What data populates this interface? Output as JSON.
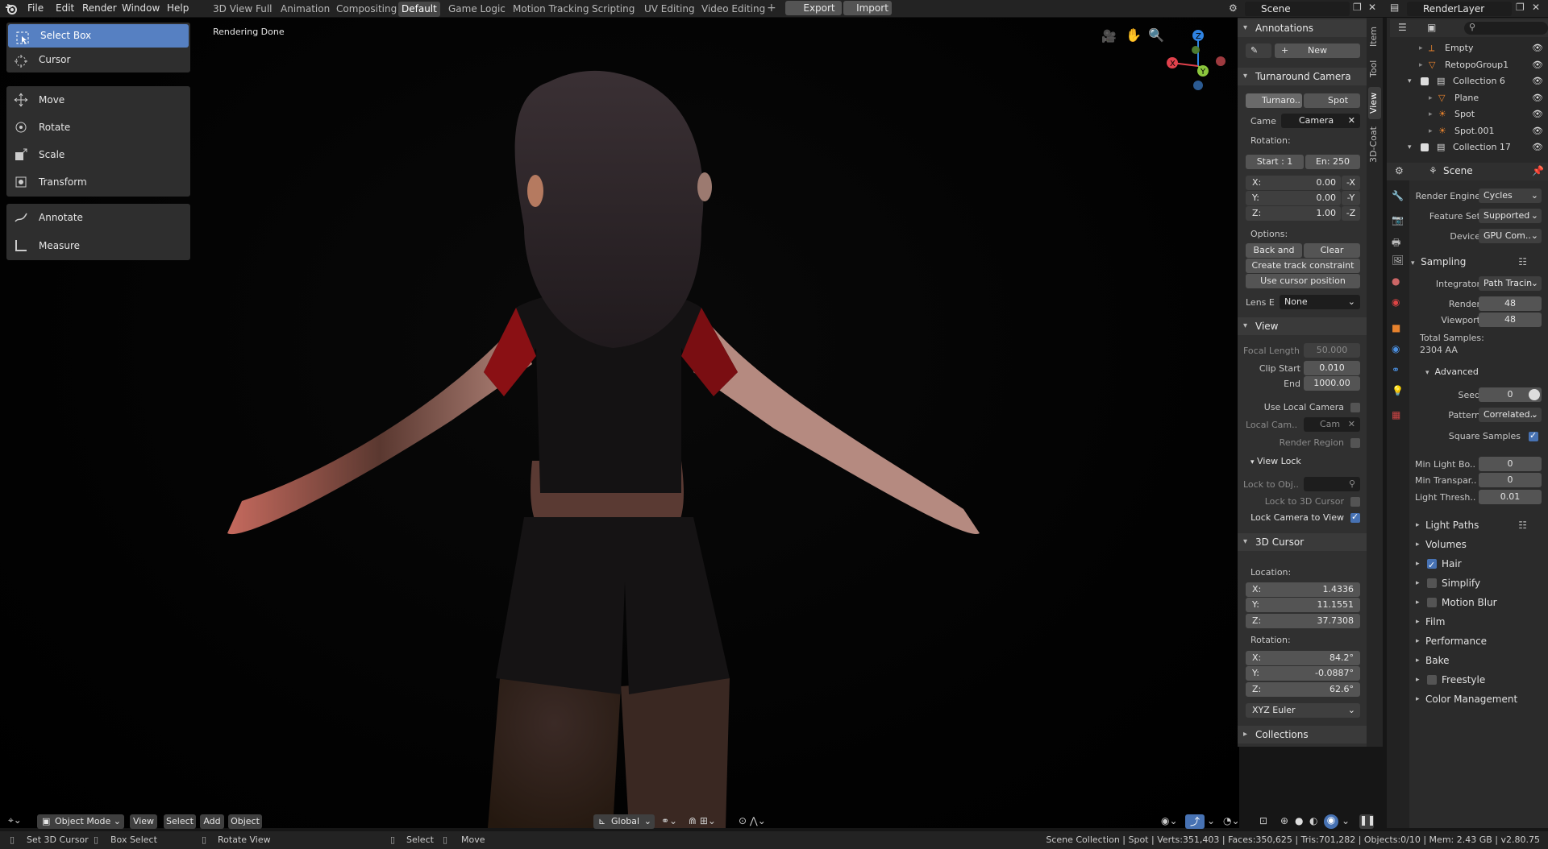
{
  "menus": [
    "File",
    "Edit",
    "Render",
    "Window",
    "Help"
  ],
  "workspaces": [
    "3D View Full",
    "Animation",
    "Compositing",
    "Default",
    "Game Logic",
    "Motion Tracking",
    "Scripting",
    "UV Editing",
    "Video Editing"
  ],
  "active_workspace": "Default",
  "export_label": "Export",
  "import_label": "Import",
  "scene_name": "Scene",
  "layer_name": "RenderLayer",
  "viewport_status": "Rendering Done",
  "tools": {
    "select_box": "Select Box",
    "cursor": "Cursor",
    "move": "Move",
    "rotate": "Rotate",
    "scale": "Scale",
    "transform": "Transform",
    "annotate": "Annotate",
    "measure": "Measure"
  },
  "vtabs": [
    "Item",
    "Tool",
    "View",
    "3D-Coat"
  ],
  "npanel": {
    "annotations": {
      "title": "Annotations",
      "new": "New"
    },
    "turnaround": {
      "title": "Turnaround Camera",
      "tab1": "Turnaro..",
      "tab2": "Spot",
      "came_label": "Came",
      "camera": "Camera",
      "rotation": "Rotation:",
      "start": "Start : 1",
      "end": "En:  250",
      "x_label": "X:",
      "x": "0.00",
      "x_btn": "-X",
      "y_label": "Y:",
      "y": "0.00",
      "y_btn": "-Y",
      "z_label": "Z:",
      "z": "1.00",
      "z_btn": "-Z",
      "options": "Options:",
      "back": "Back and fo..",
      "clear": "Clear Camera",
      "track": "Create track constraint",
      "cursorpos": "Use cursor position",
      "lens_label": "Lens E",
      "lens": "None"
    },
    "view": {
      "title": "View",
      "focal_label": "Focal Length",
      "focal": "50.000",
      "clip_start_label": "Clip Start",
      "clip_start": "0.010",
      "end_label": "End",
      "end": "1000.00",
      "local_cam": "Use Local Camera",
      "local_cam_label": "Local Cam..",
      "local_cam_val": "Cam",
      "render_region": "Render Region",
      "view_lock": "View Lock",
      "lock_obj": "Lock to Obj..",
      "lock_cursor": "Lock to 3D Cursor",
      "lock_camera": "Lock Camera to View"
    },
    "cursor": {
      "title": "3D Cursor",
      "location": "Location:",
      "lx_label": "X:",
      "lx": "1.4336",
      "ly_label": "Y:",
      "ly": "11.1551",
      "lz_label": "Z:",
      "lz": "37.7308",
      "rotation": "Rotation:",
      "rx_label": "X:",
      "rx": "84.2°",
      "ry_label": "Y:",
      "ry": "-0.0887°",
      "rz_label": "Z:",
      "rz": "62.6°",
      "mode": "XYZ Euler"
    },
    "collections": "Collections"
  },
  "outliner": [
    {
      "name": "Empty",
      "indent": 0
    },
    {
      "name": "RetopoGroup1",
      "indent": 0
    },
    {
      "name": "Collection 6",
      "indent": 0
    },
    {
      "name": "Plane",
      "indent": 1
    },
    {
      "name": "Spot",
      "indent": 1
    },
    {
      "name": "Spot.001",
      "indent": 1
    },
    {
      "name": "Collection 17",
      "indent": 0
    }
  ],
  "props": {
    "scene": "Scene",
    "render_engine_label": "Render Engine",
    "render_engine": "Cycles",
    "feature_set_label": "Feature Set",
    "feature_set": "Supported",
    "device_label": "Device",
    "device": "GPU Com..",
    "sampling": "Sampling",
    "integrator_label": "Integrator",
    "integrator": "Path Tracin",
    "render_label": "Render",
    "render": "48",
    "viewport_label": "Viewport",
    "viewport": "48",
    "total_label": "Total Samples:",
    "total": "2304 AA",
    "advanced": "Advanced",
    "seed_label": "Seed",
    "seed": "0",
    "pattern_label": "Pattern",
    "pattern": "Correlated..",
    "square": "Square Samples",
    "min_light_label": "Min Light Bo..",
    "min_light": "0",
    "min_transp_label": "Min Transpar..",
    "min_transp": "0",
    "light_thresh_label": "Light Thresh..",
    "light_thresh": "0.01",
    "sections": [
      "Light Paths",
      "Volumes",
      "Hair",
      "Simplify",
      "Motion Blur",
      "Film",
      "Performance",
      "Bake",
      "Freestyle",
      "Color Management"
    ]
  },
  "viewport_header": {
    "mode": "Object Mode",
    "view": "View",
    "select": "Select",
    "add": "Add",
    "object": "Object",
    "orientation": "Global"
  },
  "statusbar": {
    "set_cursor": "Set 3D Cursor",
    "box_select": "Box Select",
    "rotate_view": "Rotate View",
    "select": "Select",
    "move": "Move",
    "stats": "Scene Collection | Spot | Verts:351,403 | Faces:350,625 | Tris:701,282 | Objects:0/10 | Mem: 2.43 GB | v2.80.75"
  },
  "colors": {
    "accent": "#5680c2",
    "axis_x": "#e0414c",
    "axis_y": "#8bc63d",
    "axis_z": "#2f83e2"
  }
}
